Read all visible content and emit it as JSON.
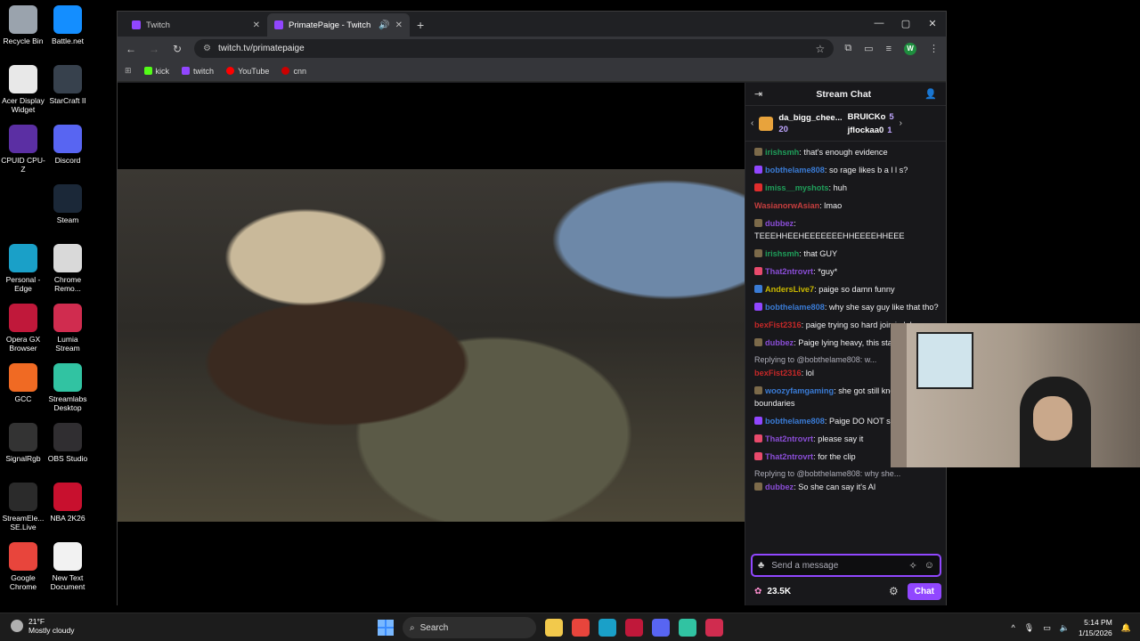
{
  "desktop": {
    "icons_col1": [
      {
        "label": "Recycle Bin",
        "icon": "recycle-bin-icon",
        "color": "#9aa3ad"
      },
      {
        "label": "Acer Display Widget",
        "icon": "display-widget-icon",
        "color": "#e8e8e8"
      },
      {
        "label": "CPUID CPU-Z",
        "icon": "cpuz-icon",
        "color": "#5b2fa3"
      },
      {
        "label": "",
        "icon": "",
        "color": "transparent"
      },
      {
        "label": "Personal - Edge",
        "icon": "edge-icon",
        "color": "#1aa0c8"
      },
      {
        "label": "Opera GX Browser",
        "icon": "opera-gx-icon",
        "color": "#c0183a"
      },
      {
        "label": "GCC",
        "icon": "gcc-icon",
        "color": "#f06a23"
      },
      {
        "label": "SignalRgb",
        "icon": "signalrgb-icon",
        "color": "#333333"
      },
      {
        "label": "StreamEle... SE.Live",
        "icon": "streamelements-icon",
        "color": "#2b2b2b"
      },
      {
        "label": "Google Chrome",
        "icon": "chrome-icon",
        "color": "#e8453c"
      }
    ],
    "icons_col2": [
      {
        "label": "Battle.net",
        "icon": "battlenet-icon",
        "color": "#148eff"
      },
      {
        "label": "StarCraft II",
        "icon": "starcraft-icon",
        "color": "#37414d"
      },
      {
        "label": "Discord",
        "icon": "discord-icon",
        "color": "#5865f2"
      },
      {
        "label": "Steam",
        "icon": "steam-icon",
        "color": "#1b2838"
      },
      {
        "label": "Chrome Remo...",
        "icon": "chrome-remote-icon",
        "color": "#d9d9d9"
      },
      {
        "label": "Lumia Stream",
        "icon": "lumia-icon",
        "color": "#d02c4f"
      },
      {
        "label": "Streamlabs Desktop",
        "icon": "streamlabs-icon",
        "color": "#31c3a2"
      },
      {
        "label": "OBS Studio",
        "icon": "obs-icon",
        "color": "#302e31"
      },
      {
        "label": "NBA 2K26",
        "icon": "nba2k-icon",
        "color": "#c8102e"
      },
      {
        "label": "New Text Document",
        "icon": "text-document-icon",
        "color": "#f2f2f2"
      }
    ]
  },
  "browser": {
    "tabs": [
      {
        "title": "Twitch",
        "active": false
      },
      {
        "title": "PrimatePaige - Twitch",
        "active": true
      }
    ],
    "url": "twitch.tv/primatepaige",
    "bookmarks": [
      {
        "label": "kick",
        "color": "#53fc18"
      },
      {
        "label": "twitch",
        "color": "#9146ff"
      },
      {
        "label": "YouTube",
        "color": "#ff0000"
      },
      {
        "label": "cnn",
        "color": "#cc0000"
      }
    ],
    "profile_initial": "W"
  },
  "chat": {
    "title": "Stream Chat",
    "leaderboard": {
      "left": {
        "name": "da_bigg_chee...",
        "count": "20"
      },
      "right": [
        {
          "name": "BRUICKo",
          "count": "5"
        },
        {
          "name": "jflockaa0",
          "count": "1"
        }
      ]
    },
    "messages": [
      {
        "user": "irishsmh",
        "color": "#1f9e5a",
        "text": ": that's enough evidence",
        "badge": "#7c6a4a",
        "reply": ""
      },
      {
        "user": "bobthelame808",
        "color": "#3a7bd5",
        "text": ": so rage likes b a l l s?",
        "badge": "#9146ff",
        "reply": ""
      },
      {
        "user": "imiss__myshots",
        "color": "#1f9e5a",
        "text": ": huh",
        "badge": "#e02d2d",
        "reply": ""
      },
      {
        "user": "WasianorwAsian",
        "color": "#c63e3e",
        "text": ": lmao",
        "badge": "",
        "reply": ""
      },
      {
        "user": "dubbez",
        "color": "#8a4dd6",
        "text": ": TEEEHHEEHEEEEEEEHHEEEEHHEEE",
        "badge": "#7c6a4a",
        "reply": ""
      },
      {
        "user": "irishsmh",
        "color": "#1f9e5a",
        "text": ": that GUY",
        "badge": "#7c6a4a",
        "reply": ""
      },
      {
        "user": "That2ntrovrt",
        "color": "#8a4dd6",
        "text": ": *guy*",
        "badge": "#e84a6c",
        "reply": ""
      },
      {
        "user": "AndersLive7",
        "color": "#c9b800",
        "text": ": paige so damn funny",
        "badge": "#3a7bd5",
        "reply": ""
      },
      {
        "user": "bobthelame808",
        "color": "#3a7bd5",
        "text": ": why she say guy like that tho?",
        "badge": "#9146ff",
        "reply": ""
      },
      {
        "user": "bexFist2316",
        "color": "#c62828",
        "text": ": paige trying so hard join in lol",
        "badge": "",
        "reply": ""
      },
      {
        "user": "dubbez",
        "color": "#8a4dd6",
        "text": ": Paige lying heavy, this stay strapped",
        "badge": "#7c6a4a",
        "reply": ""
      },
      {
        "user": "bexFist2316",
        "color": "#c62828",
        "text": ": lol",
        "badge": "",
        "reply": "Replying to @bobthelame808: w..."
      },
      {
        "user": "woozyfamgaming",
        "color": "#3a7bd5",
        "text": ": she got still knows her boundaries",
        "badge": "#7c6a4a",
        "reply": ""
      },
      {
        "user": "bobthelame808",
        "color": "#3a7bd5",
        "text": ": Paige DO NOT say it!",
        "badge": "#9146ff",
        "reply": ""
      },
      {
        "user": "That2ntrovrt",
        "color": "#8a4dd6",
        "text": ": please say it",
        "badge": "#e84a6c",
        "reply": ""
      },
      {
        "user": "That2ntrovrt",
        "color": "#8a4dd6",
        "text": ": for the clip",
        "badge": "#e84a6c",
        "reply": ""
      },
      {
        "user": "dubbez",
        "color": "#8a4dd6",
        "text": ": So she can say it's AI",
        "badge": "#7c6a4a",
        "reply": "Replying to @bobthelame808: why she..."
      }
    ],
    "input_placeholder": "Send a message",
    "points": "23.5K",
    "chat_button": "Chat",
    "accent": "#9147ff"
  },
  "taskbar": {
    "temperature": "21°F",
    "weather": "Mostly cloudy",
    "search_label": "Search",
    "time": "5:14 PM",
    "date": "1/15/2026",
    "apps": [
      {
        "icon": "file-explorer-icon",
        "color": "#f2c94c"
      },
      {
        "icon": "chrome-taskbar-icon",
        "color": "#e8453c"
      },
      {
        "icon": "edge-taskbar-icon",
        "color": "#1aa0c8"
      },
      {
        "icon": "opera-taskbar-icon",
        "color": "#c0183a"
      },
      {
        "icon": "discord-taskbar-icon",
        "color": "#5865f2"
      },
      {
        "icon": "streamlabs-taskbar-icon",
        "color": "#31c3a2"
      },
      {
        "icon": "lumia-taskbar-icon",
        "color": "#d02c4f"
      }
    ]
  }
}
